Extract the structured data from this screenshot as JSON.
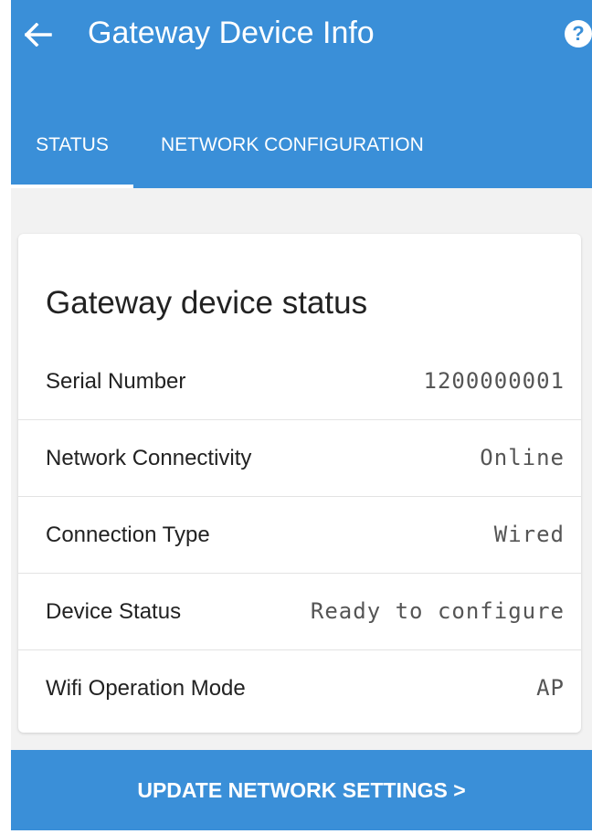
{
  "header": {
    "title": "Gateway Device Info",
    "back_icon": "arrow-left-icon",
    "help_icon": "help-icon",
    "help_glyph": "?"
  },
  "tabs": [
    {
      "label": "STATUS",
      "active": true
    },
    {
      "label": "NETWORK CONFIGURATION",
      "active": false
    }
  ],
  "card": {
    "title": "Gateway device status",
    "rows": [
      {
        "label": "Serial Number",
        "value": "1200000001"
      },
      {
        "label": "Network Connectivity",
        "value": "Online"
      },
      {
        "label": "Connection Type",
        "value": "Wired"
      },
      {
        "label": "Device Status",
        "value": "Ready to configure"
      },
      {
        "label": "Wifi Operation Mode",
        "value": "AP"
      }
    ]
  },
  "actions": {
    "update_label": "UPDATE NETWORK SETTINGS >"
  },
  "colors": {
    "primary": "#3a8fd8",
    "background": "#f2f2f2",
    "card": "#ffffff"
  }
}
